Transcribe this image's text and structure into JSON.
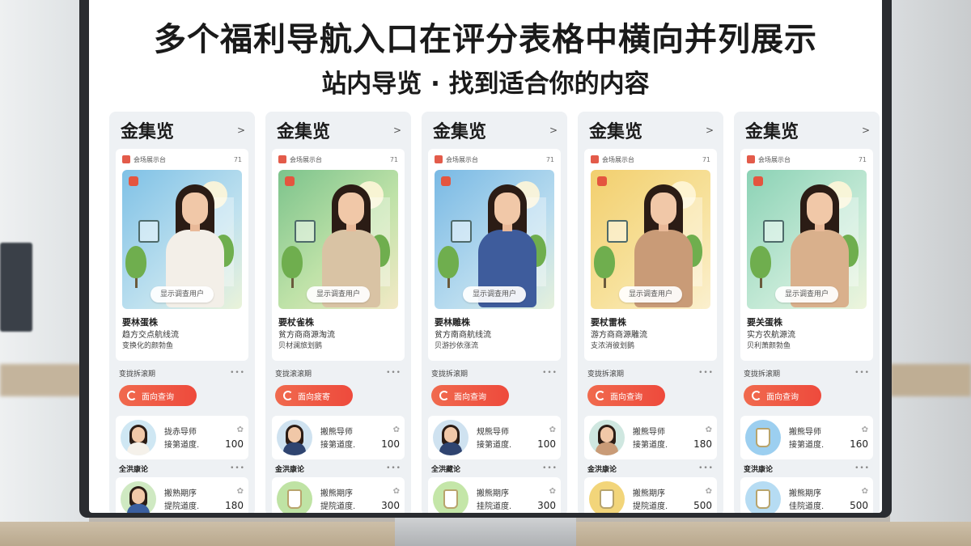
{
  "headline": "多个福利导航入口在评分表格中横向并列展示",
  "subline": "站内导览 · 找到适合你的内容",
  "colors": {
    "cta": "#ee4a3c",
    "accent": "#e4553f"
  },
  "cards": [
    {
      "title": "金集览",
      "arrow": ">",
      "mini_text": "会场展示台",
      "mini_num": "71",
      "hero_bg": "linear-gradient(135deg,#7fc1e6 0%,#bfe1ef 60%,#eaf3d9 100%)",
      "shirt": "#f3efe8",
      "pill": "显示调查用户",
      "t1": "要林蛋株",
      "t2": "趋方交点航线流",
      "t3": "变换化的颜勃鱼",
      "section1": "变拢拆滚期",
      "cta": "面向查询",
      "item1": {
        "l1": "拢赤导师",
        "l2": "接第道度.",
        "num": "100",
        "kind": "person",
        "body": "#f5f1ea",
        "bg": "#cfe7f3"
      },
      "section2": "全洪康论",
      "item2": {
        "l1": "搬熟期序",
        "l2": "提院道度.",
        "num": "180",
        "kind": "person",
        "body": "#3b5fa0",
        "bg": "#cfe9c2"
      }
    },
    {
      "title": "金集览",
      "arrow": ">",
      "mini_text": "会场展示台",
      "mini_num": "71",
      "hero_bg": "linear-gradient(135deg,#7cc38c 0%,#bfe2a8 55%,#f3e9c6 100%)",
      "shirt": "#d9c3a4",
      "pill": "显示调查用户",
      "t1": "要杖雀株",
      "t2": "贫方商商源淘流",
      "t3": "贝材澜旅划鹅",
      "section1": "变拢滚滚期",
      "cta": "面向疲寄",
      "item1": {
        "l1": "搬熊导师",
        "l2": "接第道度.",
        "num": "100",
        "kind": "person",
        "body": "#2f4470",
        "bg": "#cfe2f0"
      },
      "section2": "金洪康论",
      "item2": {
        "l1": "搬熊期序",
        "l2": "提院道度.",
        "num": "300",
        "kind": "cup",
        "body": "#ffffff",
        "bg": "#bfe3a4"
      }
    },
    {
      "title": "金集览",
      "arrow": ">",
      "mini_text": "会场展示台",
      "mini_num": "71",
      "hero_bg": "linear-gradient(135deg,#79b9e4 0%,#b9dcef 60%,#e6f1dc 100%)",
      "shirt": "#3e5c9c",
      "pill": "显示调查用户",
      "t1": "要林雕株",
      "t2": "贫方南商航线流",
      "t3": "贝游抄依涨流",
      "section1": "变拢拆滚期",
      "cta": "面向查询",
      "item1": {
        "l1": "规熊导师",
        "l2": "接第道度.",
        "num": "100",
        "kind": "person",
        "body": "#2f4470",
        "bg": "#cfe2f0"
      },
      "section2": "全洪藏论",
      "item2": {
        "l1": "搬熊期序",
        "l2": "挂院道度.",
        "num": "300",
        "kind": "cup",
        "body": "#ffffff",
        "bg": "#c4e6a8"
      }
    },
    {
      "title": "金集览",
      "arrow": ">",
      "mini_text": "会场展示台",
      "mini_num": "71",
      "hero_bg": "linear-gradient(135deg,#f2cf6e 0%,#f7e19b 55%,#fbf0cf 100%)",
      "shirt": "#c99b77",
      "pill": "显示调查用户",
      "t1": "要杖雷株",
      "t2": "游方商商源雕流",
      "t3": "支浓消彼划鹅",
      "section1": "变拢拆滚期",
      "cta": "面向查询",
      "item1": {
        "l1": "搬熊导师",
        "l2": "接第道度.",
        "num": "180",
        "kind": "person",
        "body": "#c99b77",
        "bg": "#cfe7e0"
      },
      "section2": "金洪康论",
      "item2": {
        "l1": "搬熊期序",
        "l2": "提院道度.",
        "num": "500",
        "kind": "cup",
        "body": "#ffffff",
        "bg": "#f2d57a"
      }
    },
    {
      "title": "金集览",
      "arrow": ">",
      "mini_text": "会场展示台",
      "mini_num": "71",
      "hero_bg": "linear-gradient(135deg,#8bd2b5 0%,#c6ead7 60%,#eef5dc 100%)",
      "shirt": "#d9b08c",
      "pill": "显示调查用户",
      "t1": "要关蛋株",
      "t2": "实方农航源流",
      "t3": "贝利萧颜勃鱼",
      "section1": "变拢拆滚期",
      "cta": "面向查询",
      "item1": {
        "l1": "搬熊导师",
        "l2": "接第道度.",
        "num": "160",
        "kind": "cup",
        "body": "#ffffff",
        "bg": "#9ccff0"
      },
      "section2": "变洪康论",
      "item2": {
        "l1": "搬熊期序",
        "l2": "佳院道度.",
        "num": "500",
        "kind": "cup",
        "body": "#ffffff",
        "bg": "#b6dcf3"
      }
    }
  ]
}
